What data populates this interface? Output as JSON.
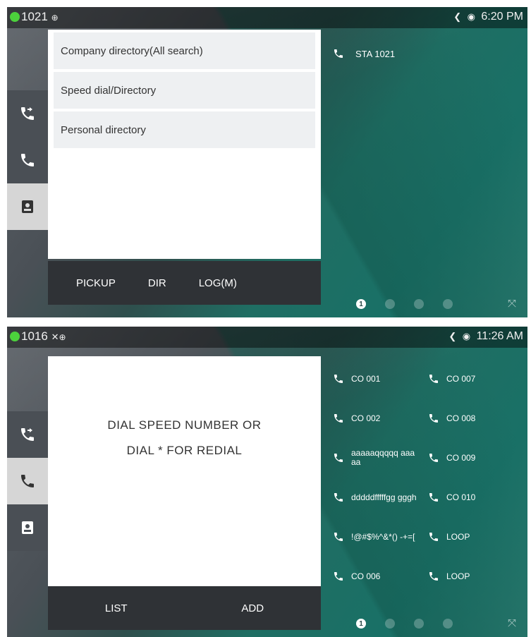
{
  "screen1": {
    "status": {
      "extension": "1021",
      "time": "6:20 PM"
    },
    "menu": [
      "Company directory(All search)",
      "Speed dial/Directory",
      "Personal directory"
    ],
    "softkeys": [
      "PICKUP",
      "DIR",
      "LOG(M)"
    ],
    "line_label": "STA 1021",
    "pager": {
      "current": "1"
    }
  },
  "screen2": {
    "status": {
      "extension": "1016",
      "time": "11:26 AM"
    },
    "message_line1": "DIAL SPEED NUMBER OR",
    "message_line2": "DIAL * FOR REDIAL",
    "softkeys": [
      "LIST",
      "ADD"
    ],
    "lines_left": [
      "CO 001",
      "CO 002",
      "aaaaaqqqqq aaaaa",
      "dddddfffffgg gggh",
      "!@#$%^&*() -+=[",
      "CO 006"
    ],
    "lines_right": [
      "CO 007",
      "CO 008",
      "CO 009",
      "CO 010",
      "LOOP",
      "LOOP"
    ],
    "pager": {
      "current": "1"
    }
  },
  "icons": {
    "status_dot": "green-status-dot",
    "side": [
      "call-forward-icon",
      "phone-icon",
      "contacts-icon"
    ]
  }
}
